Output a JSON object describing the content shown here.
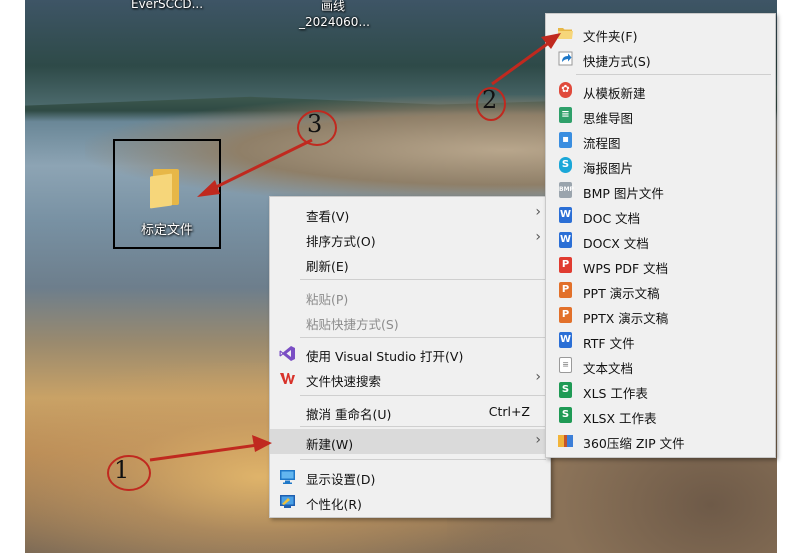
{
  "desktop": {
    "top_icons": [
      {
        "label": "EverSCCD..."
      },
      {
        "label": "画线"
      },
      {
        "label": "_2024060..."
      }
    ],
    "selected_folder_label": "标定文件"
  },
  "context_menu": {
    "items": [
      {
        "label": "查看(V)",
        "has_submenu": true
      },
      {
        "label": "排序方式(O)",
        "has_submenu": true
      },
      {
        "label": "刷新(E)"
      },
      {
        "label": "粘贴(P)",
        "disabled": true
      },
      {
        "label": "粘贴快捷方式(S)",
        "disabled": true
      },
      {
        "label": "使用 Visual Studio 打开(V)",
        "icon": "visual-studio-icon"
      },
      {
        "label": "文件快速搜索",
        "icon": "wps-icon",
        "has_submenu": true
      },
      {
        "label": "撤消 重命名(U)",
        "shortcut": "Ctrl+Z"
      },
      {
        "label": "新建(W)",
        "has_submenu": true,
        "highlighted": true
      },
      {
        "label": "显示设置(D)",
        "icon": "display-icon"
      },
      {
        "label": "个性化(R)",
        "icon": "personalize-icon"
      }
    ]
  },
  "new_submenu": {
    "items": [
      {
        "label": "文件夹(F)",
        "icon": "folder-icon"
      },
      {
        "label": "快捷方式(S)",
        "icon": "shortcut-icon"
      },
      {
        "label": "从模板新建",
        "icon": "template-icon"
      },
      {
        "label": "思维导图",
        "icon": "mindmap-icon"
      },
      {
        "label": "流程图",
        "icon": "flowchart-icon"
      },
      {
        "label": "海报图片",
        "icon": "poster-icon"
      },
      {
        "label": "BMP 图片文件",
        "icon": "bmp-icon"
      },
      {
        "label": "DOC 文档",
        "icon": "doc-icon"
      },
      {
        "label": "DOCX 文档",
        "icon": "docx-icon"
      },
      {
        "label": "WPS PDF 文档",
        "icon": "pdf-icon"
      },
      {
        "label": "PPT 演示文稿",
        "icon": "ppt-icon"
      },
      {
        "label": "PPTX 演示文稿",
        "icon": "pptx-icon"
      },
      {
        "label": "RTF 文件",
        "icon": "rtf-icon"
      },
      {
        "label": "文本文档",
        "icon": "txt-icon"
      },
      {
        "label": "XLS 工作表",
        "icon": "xls-icon"
      },
      {
        "label": "XLSX 工作表",
        "icon": "xlsx-icon"
      },
      {
        "label": "360压缩 ZIP 文件",
        "icon": "zip-icon"
      }
    ]
  },
  "annotations": {
    "step1": "1",
    "step2": "2",
    "step3": "3",
    "color": "#c0291f"
  }
}
